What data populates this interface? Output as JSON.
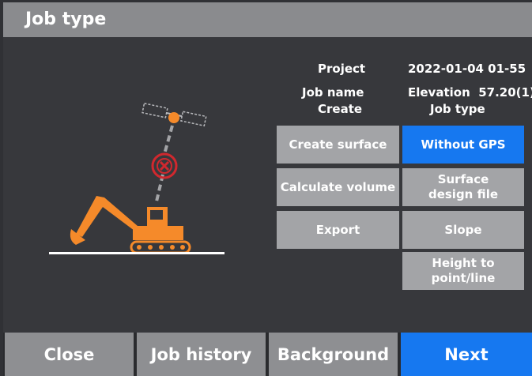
{
  "header": {
    "title": "Job type"
  },
  "info": {
    "project_label": "Project",
    "project_value": "2022-01-04 01-55",
    "jobname_label": "Job name",
    "jobname_value": "Elevation  57.20(1)",
    "create_label": "Create",
    "jobtype_label": "Job type"
  },
  "create_options": [
    {
      "label": "Create surface"
    },
    {
      "label": "Calculate volume"
    },
    {
      "label": "Export"
    }
  ],
  "jobtype_options": [
    {
      "label": "Without GPS",
      "selected": true
    },
    {
      "label": "Surface design file"
    },
    {
      "label": "Slope"
    },
    {
      "label": "Height to point/line"
    }
  ],
  "footer": {
    "close_label": "Close",
    "history_label": "Job history",
    "background_label": "Background",
    "next_label": "Next"
  },
  "colors": {
    "accent": "#1678f0",
    "illustration": "#f58a2a",
    "no_signal": "#d1282e"
  },
  "illustration": {
    "icons": [
      "satellite-icon",
      "no-signal-icon",
      "excavator-icon"
    ]
  }
}
